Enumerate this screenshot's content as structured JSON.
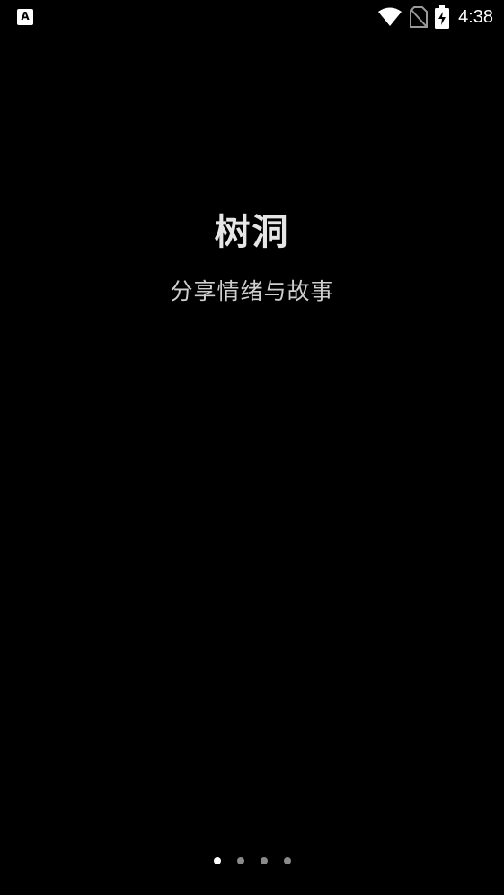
{
  "status_bar": {
    "notification_icon": "app-notification-icon",
    "notification_letter": "A",
    "icons": [
      "wifi-icon",
      "no-sim-icon",
      "battery-charging-icon"
    ],
    "time": "4:38"
  },
  "splash": {
    "title": "树洞",
    "subtitle": "分享情绪与故事"
  },
  "page_indicator": {
    "count": 4,
    "active_index": 0
  },
  "colors": {
    "background": "#000000",
    "dot_active": "#ffffff",
    "dot_inactive": "#8a8a8a"
  }
}
